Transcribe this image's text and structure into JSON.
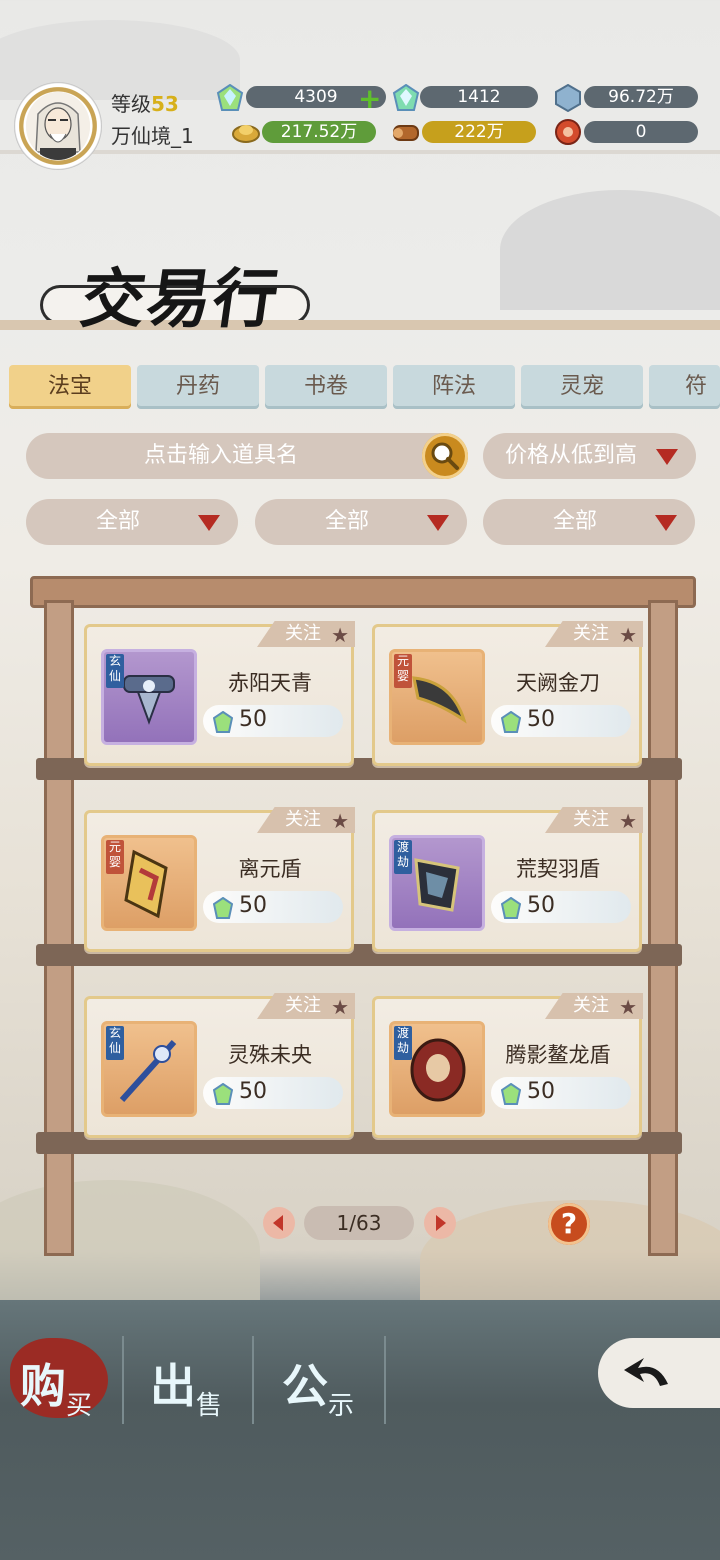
{
  "player": {
    "level_label": "等级",
    "level_value": "53",
    "realm": "万仙境_1"
  },
  "resources": [
    {
      "name": "jade-crystal",
      "value": "4309",
      "has_plus": true
    },
    {
      "name": "premium-jade",
      "value": "1412"
    },
    {
      "name": "blue-stone",
      "value": "96.72万"
    },
    {
      "name": "gold-ingot",
      "value": "217.52万"
    },
    {
      "name": "wood-log",
      "value": "222万"
    },
    {
      "name": "red-token",
      "value": "0"
    }
  ],
  "title": "交易行",
  "tabs": [
    "法宝",
    "丹药",
    "书卷",
    "阵法",
    "灵宠",
    "符"
  ],
  "active_tab": 0,
  "search": {
    "placeholder": "点击输入道具名"
  },
  "sort": {
    "label": "价格从低到高"
  },
  "filters": [
    "全部",
    "全部",
    "全部"
  ],
  "follow_label": "关注",
  "items": [
    {
      "name": "赤阳天青",
      "price": "50",
      "rank": "玄仙",
      "frame": "purple"
    },
    {
      "name": "天阙金刀",
      "price": "50",
      "rank": "元婴",
      "frame": "orange"
    },
    {
      "name": "离元盾",
      "price": "50",
      "rank": "元婴",
      "frame": "orange"
    },
    {
      "name": "荒契羽盾",
      "price": "50",
      "rank": "渡劫",
      "frame": "purple"
    },
    {
      "name": "灵殊未央",
      "price": "50",
      "rank": "玄仙",
      "frame": "orange"
    },
    {
      "name": "腾影鳌龙盾",
      "price": "50",
      "rank": "渡劫",
      "frame": "orange"
    }
  ],
  "pagination": {
    "text": "1/63"
  },
  "help_label": "?",
  "bottom_tabs": [
    {
      "big": "购",
      "small": "买"
    },
    {
      "big": "出",
      "small": "售"
    },
    {
      "big": "公",
      "small": "示"
    }
  ],
  "colors": {
    "accent_gold": "#f1d18a",
    "tab_blue": "#c8d9dd",
    "seal_red": "#9b2b24",
    "price_gem": "#8fd67a"
  }
}
